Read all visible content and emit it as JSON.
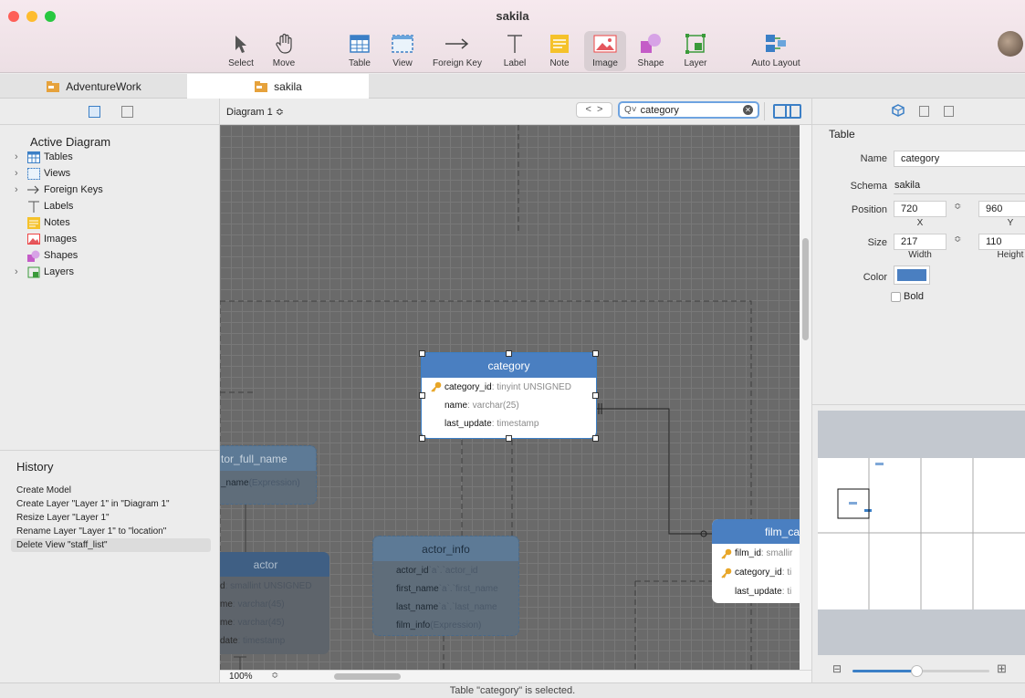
{
  "window": {
    "title": "sakila"
  },
  "toolbar": {
    "items": [
      {
        "label": "Select",
        "icon": "arrow-cursor-icon"
      },
      {
        "label": "Move",
        "icon": "hand-icon"
      },
      {
        "label": "Table",
        "icon": "table-icon"
      },
      {
        "label": "View",
        "icon": "view-icon"
      },
      {
        "label": "Foreign Key",
        "icon": "foreign-key-icon"
      },
      {
        "label": "Label",
        "icon": "label-icon"
      },
      {
        "label": "Note",
        "icon": "note-icon"
      },
      {
        "label": "Image",
        "icon": "image-icon"
      },
      {
        "label": "Shape",
        "icon": "shape-icon"
      },
      {
        "label": "Layer",
        "icon": "layer-icon"
      },
      {
        "label": "Auto Layout",
        "icon": "auto-layout-icon"
      }
    ]
  },
  "tabs": [
    {
      "label": "AdventureWork"
    },
    {
      "label": "sakila"
    }
  ],
  "left": {
    "heading": "Active Diagram",
    "tree": [
      {
        "label": "Tables",
        "expandable": true
      },
      {
        "label": "Views",
        "expandable": true
      },
      {
        "label": "Foreign Keys",
        "expandable": true
      },
      {
        "label": "Labels",
        "expandable": false
      },
      {
        "label": "Notes",
        "expandable": false
      },
      {
        "label": "Images",
        "expandable": false
      },
      {
        "label": "Shapes",
        "expandable": false
      },
      {
        "label": "Layers",
        "expandable": true
      }
    ],
    "history_title": "History",
    "history": [
      "Create Model",
      "Create Layer \"Layer 1\" in \"Diagram 1\"",
      "Resize Layer \"Layer 1\"",
      "Rename Layer \"Layer 1\" to \"location\"",
      "Delete View \"staff_list\""
    ]
  },
  "canvas": {
    "diagram": "Diagram 1 ≎",
    "search_value": "category",
    "zoom": "100%",
    "tables": {
      "category": {
        "title": "category",
        "rows": [
          {
            "name": "category_id",
            "type": ": tinyint UNSIGNED"
          },
          {
            "name": "name",
            "type": ": varchar(25)"
          },
          {
            "name": "last_update",
            "type": ": timestamp"
          }
        ]
      },
      "actor_full_name": {
        "title": "tor_full_name",
        "rows": [
          {
            "name": "_name",
            "type": " (Expression)"
          }
        ]
      },
      "actor": {
        "title": "actor",
        "rows": [
          {
            "name": "d",
            "type": ": smallint UNSIGNED"
          },
          {
            "name": "me",
            "type": ": varchar(45)"
          },
          {
            "name": "me",
            "type": ": varchar(45)"
          },
          {
            "name": "date",
            "type": ": timestamp"
          }
        ]
      },
      "actor_info": {
        "title": "actor_info",
        "rows": [
          {
            "name": "actor_id",
            "type": "  `a`.`actor_id"
          },
          {
            "name": "first_name",
            "type": "  `a`.`first_name"
          },
          {
            "name": "last_name",
            "type": "  `a`.`last_name"
          },
          {
            "name": "film_info",
            "type": "  (Expression)"
          }
        ]
      },
      "film_category": {
        "title": "film_ca",
        "rows": [
          {
            "name": "film_id",
            "type": ": smallir"
          },
          {
            "name": "category_id",
            "type": ": ti"
          },
          {
            "name": "last_update",
            "type": ": ti"
          }
        ]
      }
    }
  },
  "inspector": {
    "section": "Table",
    "name_label": "Name",
    "name": "category",
    "schema_label": "Schema",
    "schema": "sakila",
    "position_label": "Position",
    "pos_x": "720",
    "pos_y": "960",
    "x_label": "X",
    "y_label": "Y",
    "size_label": "Size",
    "width": "217",
    "height": "110",
    "width_label": "Width",
    "height_label": "Height",
    "color_label": "Color",
    "color": "#4a7fc1",
    "bold_label": "Bold"
  },
  "status": "Table \"category\" is selected."
}
